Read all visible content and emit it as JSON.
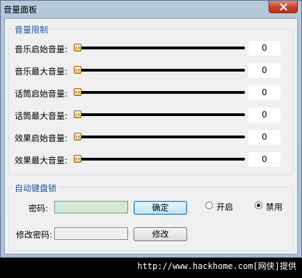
{
  "window": {
    "title": "音量面板"
  },
  "volume_limits": {
    "title": "音量限制",
    "rows": [
      {
        "label": "音乐启始音量:",
        "value": "0"
      },
      {
        "label": "音乐最大音量:",
        "value": "0"
      },
      {
        "label": "话筒启始音量:",
        "value": "0"
      },
      {
        "label": "话筒最大音量:",
        "value": "0"
      },
      {
        "label": "效果启始音量:",
        "value": "0"
      },
      {
        "label": "效果最大音量:",
        "value": "0"
      }
    ]
  },
  "keyboard_lock": {
    "title": "自动键盘锁",
    "password_label": "密码:",
    "password_value": "",
    "confirm_label": "确定",
    "enable_label": "开启",
    "disable_label": "禁用",
    "selected": "禁用",
    "change_password_label": "修改密码:",
    "change_password_value": "",
    "modify_label": "修改"
  },
  "watermark": "http://www.hackhome.com[网侠]提供",
  "colors": {
    "group_title": "#1e56a0",
    "password_field_bg": "#d3ebd8"
  },
  "icons": {
    "close": "close-icon"
  }
}
